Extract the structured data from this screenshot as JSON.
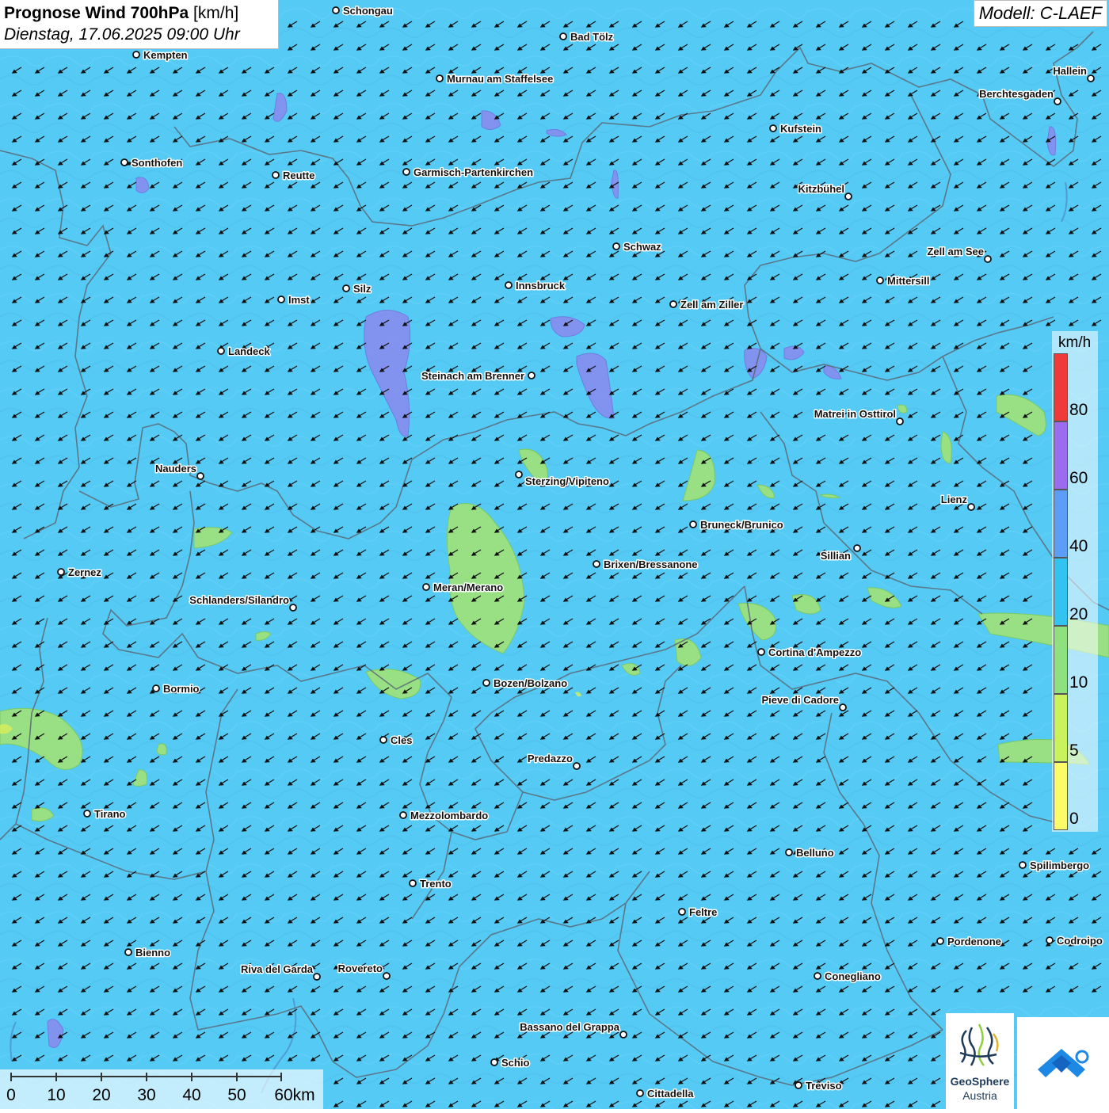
{
  "header": {
    "title_bold": "Prognose Wind 700hPa",
    "title_unit": "[km/h]",
    "datetime": "Dienstag, 17.06.2025 09:00 Uhr",
    "model": "Modell: C-LAEF"
  },
  "colors": {
    "background_field": "#55caf5",
    "field_green": "#9ee27a",
    "field_purple": "#8a89ee",
    "arrow": "#111111",
    "border_line": "#5a6a78"
  },
  "legend": {
    "unit": "km/h",
    "levels": [
      {
        "label": "80",
        "color": "#f03a3a"
      },
      {
        "label": "60",
        "color": "#9b6cf0"
      },
      {
        "label": "40",
        "color": "#5c9df5"
      },
      {
        "label": "20",
        "color": "#33c3f0"
      },
      {
        "label": "10",
        "color": "#8fe07e"
      },
      {
        "label": "5",
        "color": "#c9f25c"
      },
      {
        "label": "0",
        "color": "#fbfb6a"
      }
    ]
  },
  "scalebar": {
    "labels": [
      "0",
      "10",
      "20",
      "30",
      "40",
      "50",
      "60km"
    ]
  },
  "logo": {
    "name": "GeoSphere",
    "sub": "Austria"
  },
  "wind": {
    "direction": "from northeast",
    "arrow_icon": "wind-arrow-icon"
  },
  "cities": [
    {
      "name": "Schongau"
    },
    {
      "name": "Bad Tölz"
    },
    {
      "name": "Kempten"
    },
    {
      "name": "Murnau am Staffelsee"
    },
    {
      "name": "Hallein"
    },
    {
      "name": "Berchtesgaden"
    },
    {
      "name": "Kufstein"
    },
    {
      "name": "Sonthofen"
    },
    {
      "name": "Reutte"
    },
    {
      "name": "Garmisch-Partenkirchen"
    },
    {
      "name": "Kitzbühel"
    },
    {
      "name": "Schwaz"
    },
    {
      "name": "Zell am See"
    },
    {
      "name": "Mittersill"
    },
    {
      "name": "Innsbruck"
    },
    {
      "name": "Silz"
    },
    {
      "name": "Imst"
    },
    {
      "name": "Zell am Ziller"
    },
    {
      "name": "Landeck"
    },
    {
      "name": "Steinach am Brenner"
    },
    {
      "name": "Matrei in Osttirol"
    },
    {
      "name": "Nauders"
    },
    {
      "name": "Sterzing/Vipiteno"
    },
    {
      "name": "Lienz"
    },
    {
      "name": "Bruneck/Brunico"
    },
    {
      "name": "Sillian"
    },
    {
      "name": "Zernez"
    },
    {
      "name": "Brixen/Bressanone"
    },
    {
      "name": "Meran/Merano"
    },
    {
      "name": "Schlanders/Silandro"
    },
    {
      "name": "Cortina d'Ampezzo"
    },
    {
      "name": "Bozen/Bolzano"
    },
    {
      "name": "Bormio"
    },
    {
      "name": "Pieve di Cadore"
    },
    {
      "name": "Cles"
    },
    {
      "name": "Predazzo"
    },
    {
      "name": "Tirano"
    },
    {
      "name": "Mezzolombardo"
    },
    {
      "name": "Belluno"
    },
    {
      "name": "Spilimbergo"
    },
    {
      "name": "Trento"
    },
    {
      "name": "Feltre"
    },
    {
      "name": "Pordenone"
    },
    {
      "name": "Codroipo"
    },
    {
      "name": "Bienno"
    },
    {
      "name": "Riva del Garda"
    },
    {
      "name": "Rovereto"
    },
    {
      "name": "Conegliano"
    },
    {
      "name": "Bassano del Grappa"
    },
    {
      "name": "Schio"
    },
    {
      "name": "Treviso"
    },
    {
      "name": "Cittadella"
    }
  ]
}
